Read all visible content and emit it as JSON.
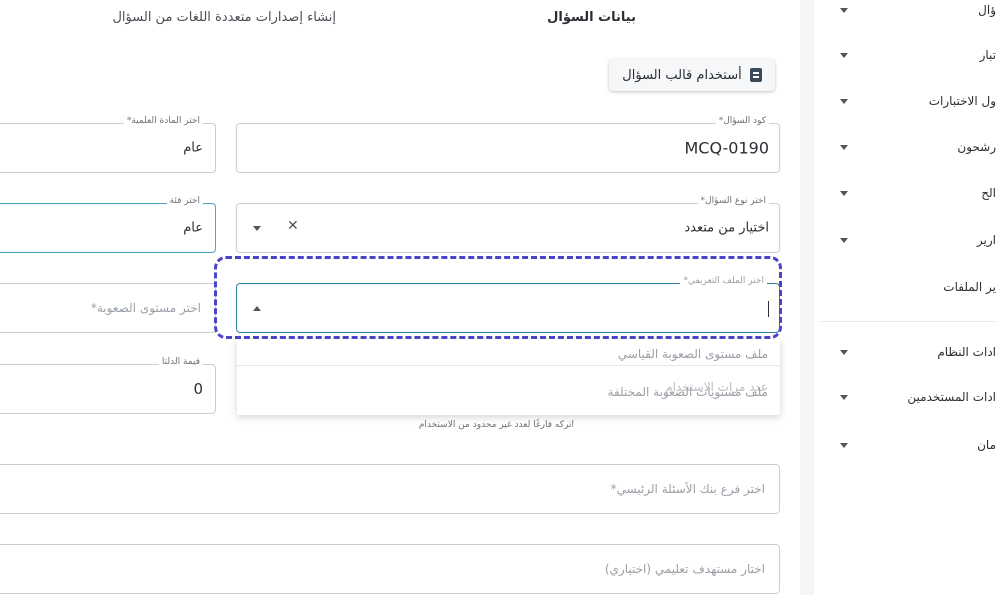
{
  "tabs": {
    "active": "بيانات السؤال",
    "other": "إنشاء إصدارات متعددة اللغات من السؤال"
  },
  "template_button": {
    "label": "أستخدام قالب السؤال",
    "icon": "document-icon"
  },
  "fields": {
    "question_code": {
      "label": "كود السؤال*",
      "value": "MCQ-0190"
    },
    "subject": {
      "label": "اختر المادة العلمية*",
      "value": "عام"
    },
    "question_type": {
      "label": "اختر نوع السؤال*",
      "value": "اختيار من متعدد"
    },
    "category": {
      "label": "اختر فئة",
      "value": "عام"
    },
    "profile_file": {
      "label": "اختر الملف التعريفي*"
    },
    "difficulty": {
      "placeholder": "اختر مستوى الصعوبة*"
    },
    "delta": {
      "label": "قيمة الدلتا",
      "value": "0"
    },
    "main_bank_branch": {
      "placeholder": "اختر فرع بنك الأسئلة الرئيسي*"
    },
    "learning_target": {
      "placeholder": "اختار مستهدف تعليمي (اختياري)"
    }
  },
  "dropdown": {
    "options": [
      "ملف مستوى الصعوبة القياسي",
      "ملف مستويات الصعوبة المختلفة"
    ],
    "underlying_text": "عدد مرات الاستخدام"
  },
  "usage_hint": "اتركه فارغًا لعدد غير محدود من الاستخدام",
  "sidebar": {
    "items": [
      {
        "label": "ؤال",
        "has_chevron": true
      },
      {
        "label": "تبار",
        "has_chevron": true
      },
      {
        "label": "ول الاختبارات",
        "has_chevron": true
      },
      {
        "label": "رشحون",
        "has_chevron": true
      },
      {
        "label": "الح",
        "has_chevron": true
      },
      {
        "label": "ارير",
        "has_chevron": true
      },
      {
        "label": "ير الملفات",
        "has_chevron": false
      },
      {
        "label": "ادات النظام",
        "has_chevron": true
      },
      {
        "label": "ادات المستخدمين",
        "has_chevron": true
      },
      {
        "label": "مان",
        "has_chevron": true
      }
    ]
  },
  "colors": {
    "highlight": "#4b43c9",
    "focus_border": "#2f7fa3",
    "field_border": "#c9ced3",
    "gutter": "#f5f6f8"
  }
}
